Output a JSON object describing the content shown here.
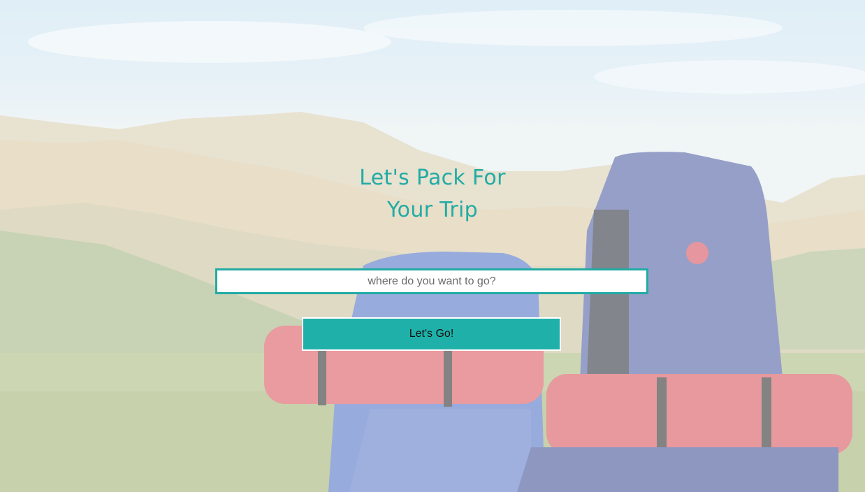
{
  "hero": {
    "title_line1": "Let's Pack For",
    "title_line2": "Your Trip"
  },
  "search": {
    "placeholder": "where do you want to go?",
    "value": ""
  },
  "cta": {
    "label": "Let's Go!"
  },
  "background": {
    "image_subject": "backpacks-in-mountain-meadow"
  },
  "colors": {
    "accent": "#22aba4",
    "button": "#1fb1a9"
  }
}
